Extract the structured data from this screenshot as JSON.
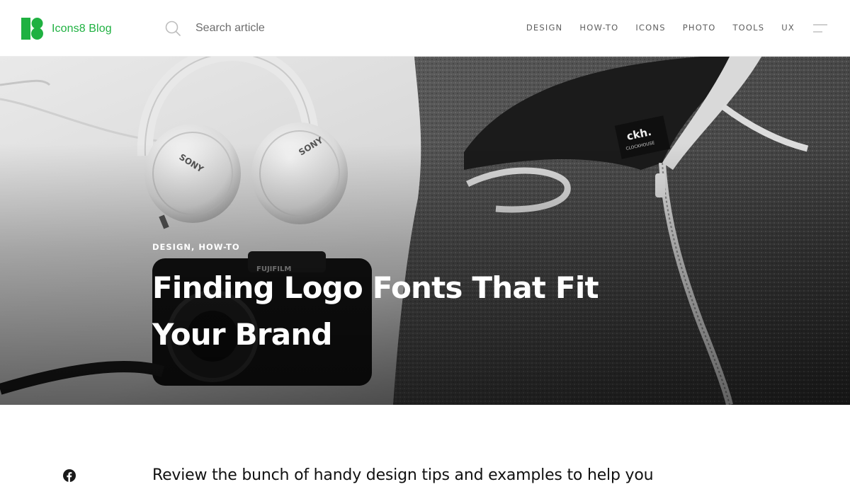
{
  "header": {
    "logo_text": "Icons8 Blog",
    "brand_color": "#1fb141",
    "search": {
      "placeholder": "Search article",
      "value": ""
    },
    "nav": [
      "DESIGN",
      "HOW-TO",
      "ICONS",
      "PHOTO",
      "TOOLS",
      "UX"
    ],
    "menu_icon": "hamburger-icon"
  },
  "hero": {
    "categories": "DESIGN, HOW-TO",
    "title": "Finding Logo Fonts That Fit Your Brand",
    "photo_labels": {
      "headphones_brand": "SONY",
      "camera_brand": "FUJIFILM",
      "hoodie_tag_logo": "ckh.",
      "hoodie_tag_name": "CLOCKHOUSE"
    }
  },
  "article": {
    "intro": "Review the bunch of handy design tips and examples to help you",
    "share_icon": "facebook-icon"
  }
}
